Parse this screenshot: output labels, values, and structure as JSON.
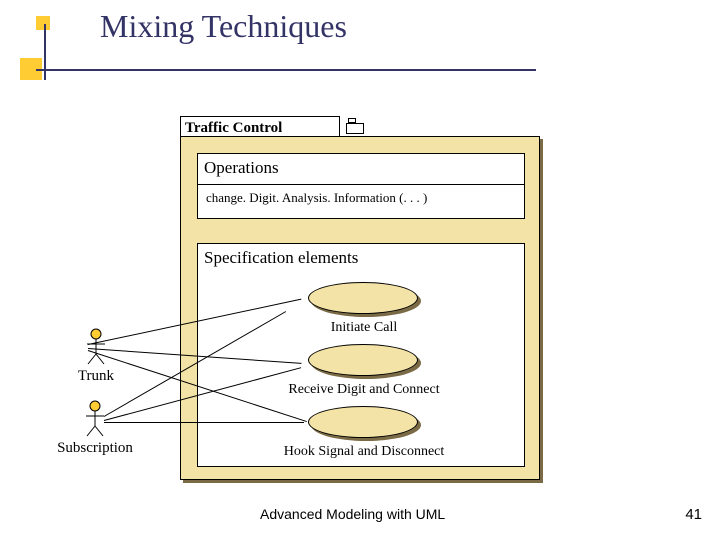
{
  "title": "Mixing Techniques",
  "package": {
    "title": "Traffic Control"
  },
  "sections": {
    "operations": {
      "header": "Operations",
      "item": "change. Digit. Analysis. Information (. . . )"
    },
    "spec": {
      "header": "Specification elements",
      "usecases": {
        "uc1": "Initiate Call",
        "uc2": "Receive Digit and Connect",
        "uc3": "Hook Signal and Disconnect"
      }
    }
  },
  "actors": {
    "trunk": "Trunk",
    "subscription": "Subscription"
  },
  "footer": "Advanced Modeling with UML",
  "page": "41"
}
